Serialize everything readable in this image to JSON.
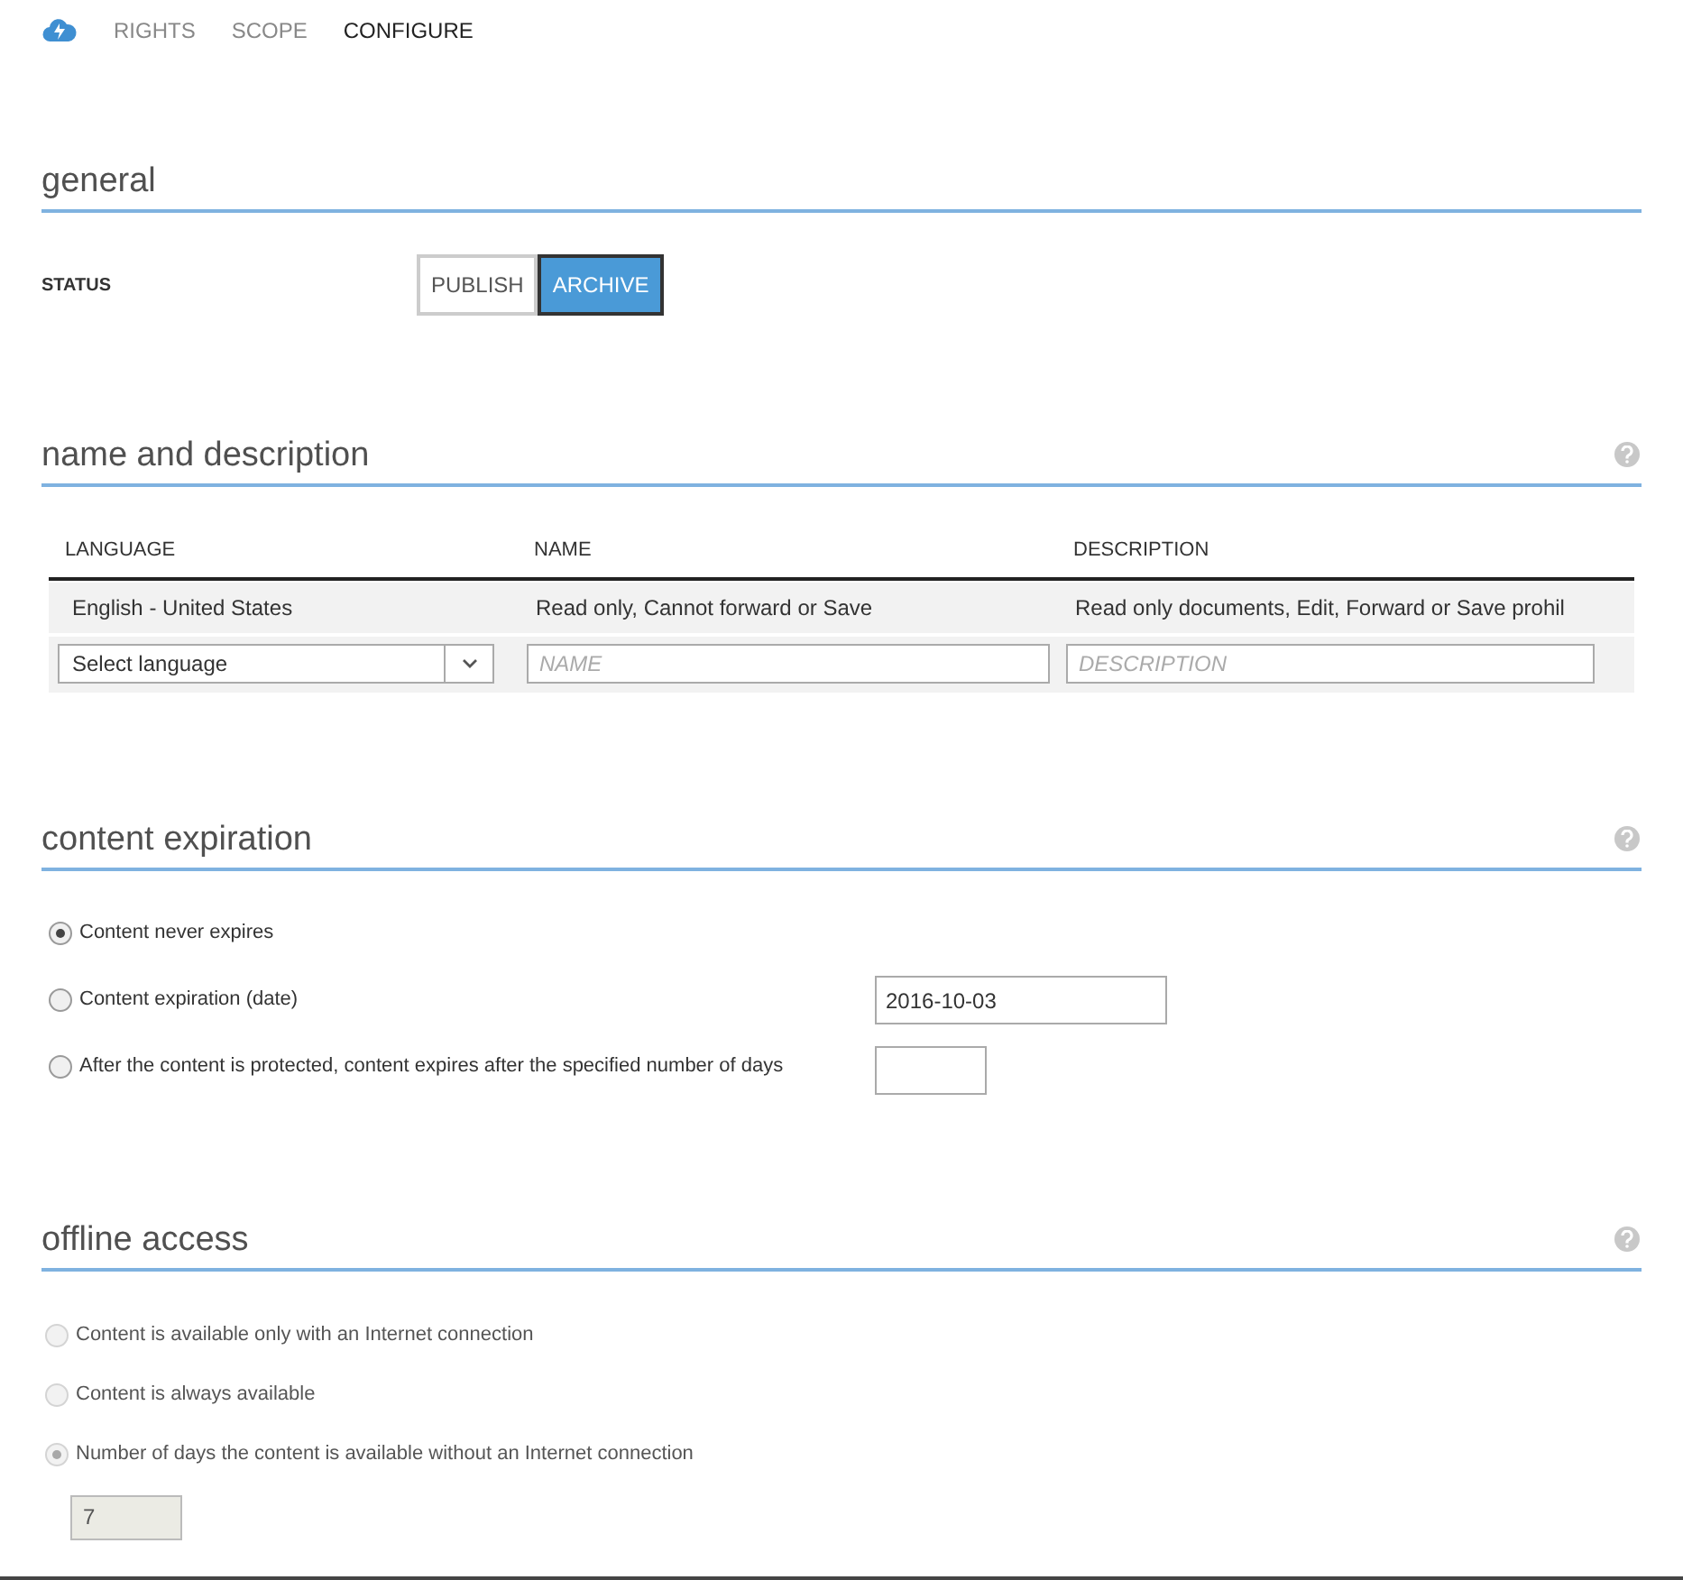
{
  "nav": {
    "tabs": [
      {
        "label": "RIGHTS",
        "selected": false
      },
      {
        "label": "SCOPE",
        "selected": false
      },
      {
        "label": "CONFIGURE",
        "selected": true
      }
    ]
  },
  "general": {
    "title": "general",
    "status_label": "STATUS",
    "options": [
      {
        "label": "PUBLISH",
        "selected": false
      },
      {
        "label": "ARCHIVE",
        "selected": true
      }
    ]
  },
  "name_and_description": {
    "title": "name and description",
    "columns": [
      "LANGUAGE",
      "NAME",
      "DESCRIPTION"
    ],
    "rows": [
      {
        "language": "English - United States",
        "name": "Read only, Cannot forward or Save",
        "description": "Read only documents, Edit, Forward or Save prohil"
      }
    ],
    "new_row": {
      "language_select": "Select language",
      "name_placeholder": "NAME",
      "description_placeholder": "DESCRIPTION"
    }
  },
  "content_expiration": {
    "title": "content expiration",
    "options": [
      {
        "label": "Content never expires",
        "selected": true,
        "disabled": false,
        "kind": "plain"
      },
      {
        "label": "Content expiration (date)",
        "selected": false,
        "disabled": false,
        "kind": "date",
        "value": "2016-10-03"
      },
      {
        "label": "After the content is protected, content expires after the specified number of days",
        "selected": false,
        "disabled": false,
        "kind": "days"
      }
    ]
  },
  "offline_access": {
    "title": "offline access",
    "options": [
      {
        "label": "Content is available only with an Internet connection",
        "selected": false,
        "disabled": true
      },
      {
        "label": "Content is always available",
        "selected": false,
        "disabled": true
      },
      {
        "label": "Number of days the content is available without an Internet connection",
        "selected": true,
        "disabled": true
      }
    ],
    "days": {
      "value": "7",
      "disabled": true
    }
  }
}
